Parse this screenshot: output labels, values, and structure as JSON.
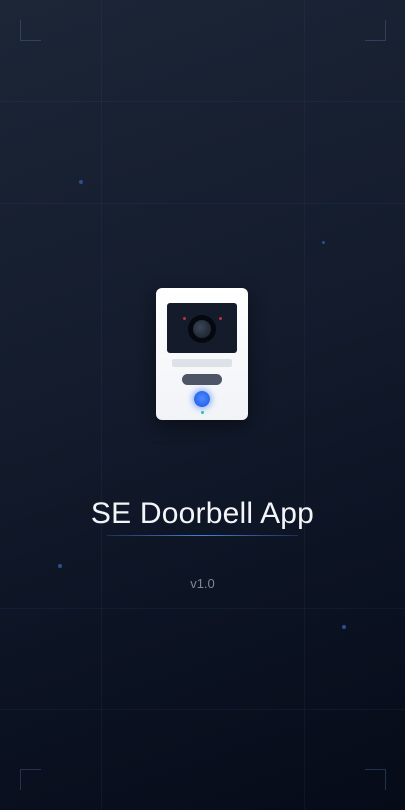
{
  "app": {
    "title": "SE Doorbell App",
    "version": "v1.0"
  },
  "theme": {
    "background_top": "#1c2637",
    "background_bottom": "#060b18",
    "accent": "#2d6af0",
    "status_led": "#27c4a8"
  },
  "icons": {
    "logo": "doorbell-icon"
  }
}
